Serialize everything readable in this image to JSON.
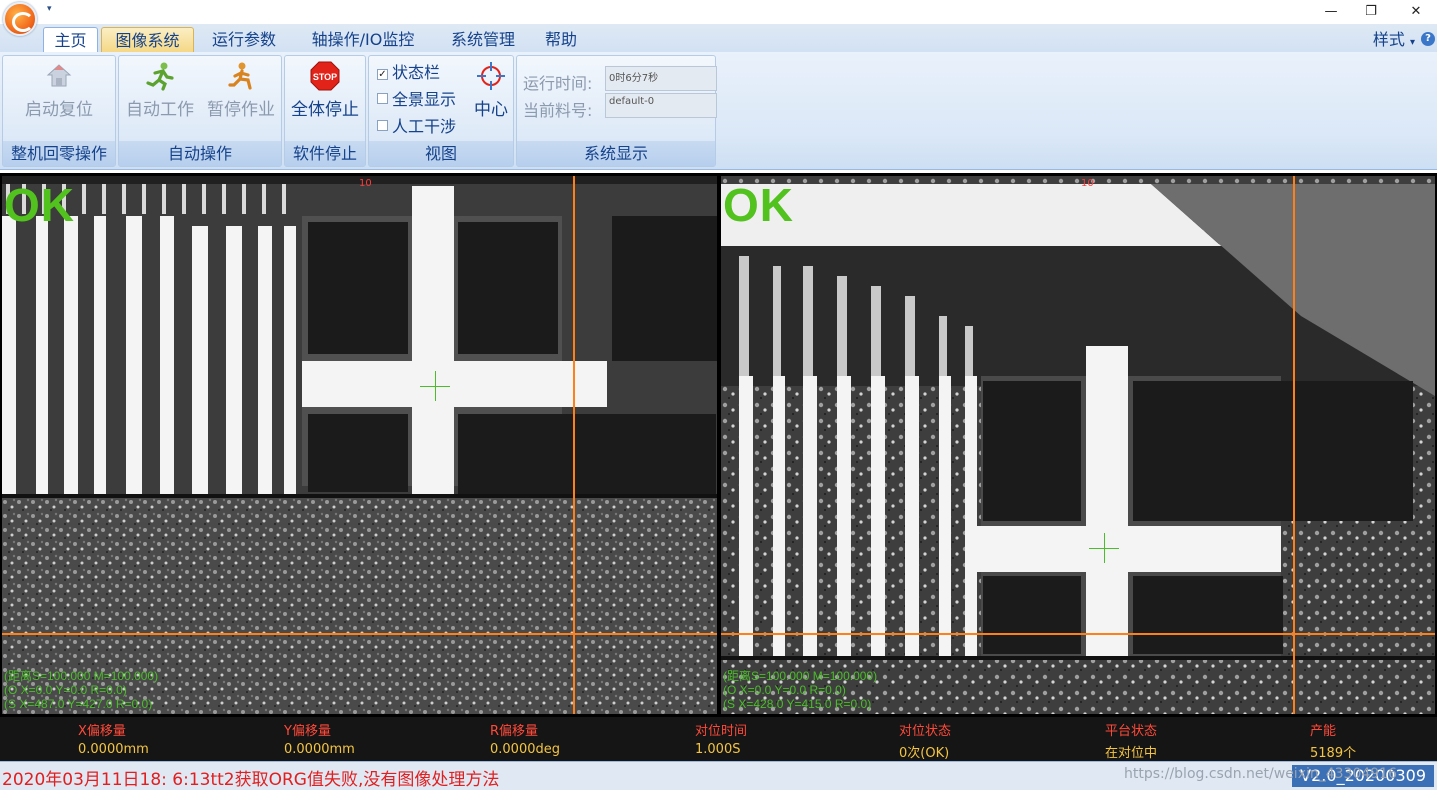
{
  "window": {
    "quick_access": "▾",
    "minimize": "—",
    "restore": "❐",
    "close": "✕"
  },
  "tabs": [
    {
      "label": "主页"
    },
    {
      "label": "图像系统"
    },
    {
      "label": "运行参数"
    },
    {
      "label": "轴操作/IO监控"
    },
    {
      "label": "系统管理"
    },
    {
      "label": "帮助"
    }
  ],
  "style_menu": "样式",
  "ribbon": {
    "groups": [
      {
        "label": "整机回零操作",
        "buttons": [
          {
            "label": "启动复位",
            "icon": "home-reset-icon",
            "enabled": false
          }
        ]
      },
      {
        "label": "自动操作",
        "buttons": [
          {
            "label": "自动工作",
            "icon": "running-man-icon",
            "enabled": false
          },
          {
            "label": "暂停作业",
            "icon": "sitting-man-icon",
            "enabled": false
          }
        ]
      },
      {
        "label": "软件停止",
        "buttons": [
          {
            "label": "全体停止",
            "icon": "stop-sign-icon",
            "icon_text": "STOP",
            "enabled": true
          }
        ]
      },
      {
        "label": "视图",
        "checkboxes": [
          {
            "label": "状态栏",
            "checked": true
          },
          {
            "label": "全景显示",
            "checked": false
          },
          {
            "label": "人工干涉",
            "checked": false
          }
        ],
        "buttons": [
          {
            "label": "中心",
            "icon": "crosshair-icon",
            "enabled": true
          }
        ]
      },
      {
        "label": "系统显示",
        "fields": [
          {
            "label": "运行时间:",
            "value": "0时6分7秒"
          },
          {
            "label": "当前料号:",
            "value": "default-0"
          }
        ]
      }
    ]
  },
  "cameras": [
    {
      "result": "OK",
      "info": [
        "(距离S=100.000 M=100.000)",
        "(O X=0.0 Y=0.0 R=0.0)",
        "(S X=487.0 Y=427.0 R=0.0)"
      ],
      "marker": "10"
    },
    {
      "result": "OK",
      "info": [
        "(距离S=100.000 M=100.000)",
        "(O X=0.0 Y=0.0 R=0.0)",
        "(S X=428.0 Y=415.0 R=0.0)"
      ],
      "marker": "10"
    }
  ],
  "status": [
    {
      "label": "X偏移量",
      "value": "0.0000mm"
    },
    {
      "label": "Y偏移量",
      "value": "0.0000mm"
    },
    {
      "label": "R偏移量",
      "value": "0.0000deg"
    },
    {
      "label": "对位时间",
      "value": "1.000S"
    },
    {
      "label": "对位状态",
      "value": "0次(OK)"
    },
    {
      "label": "平台状态",
      "value": "在对位中"
    },
    {
      "label": "产能",
      "value": "5189个"
    }
  ],
  "message": "2020年03月11日18: 6:13tt2获取ORG值失败,没有图像处理方法",
  "version": "V2.0_20200309",
  "watermark": "https://blog.csdn.net/weixin_43304916",
  "colors": {
    "accent": "#15428b",
    "ok_green": "#52c21e",
    "crosshair_orange": "#ff7f1a",
    "status_red": "#ff4a3a",
    "status_yellow": "#f4c542",
    "message_red": "#e02020"
  }
}
